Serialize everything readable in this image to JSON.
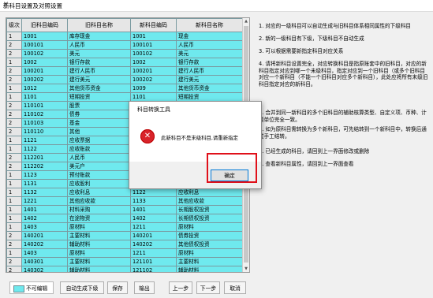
{
  "window": {
    "title": "新科目设置及对照设置",
    "close_glyph": "✕"
  },
  "grid": {
    "headers": [
      "级次",
      "旧科目编码",
      "旧科目名称",
      "新科目编码",
      "新科目名称"
    ],
    "rows": [
      [
        "1",
        "1001",
        "库存现金",
        "1001",
        "现金"
      ],
      [
        "2",
        "100101",
        "人民币",
        "100101",
        "人民币"
      ],
      [
        "2",
        "100102",
        "美元",
        "100102",
        "美元"
      ],
      [
        "1",
        "1002",
        "银行存款",
        "1002",
        "银行存款"
      ],
      [
        "2",
        "100201",
        "建行人民币",
        "100201",
        "建行人民币"
      ],
      [
        "2",
        "100202",
        "建行美元",
        "100202",
        "建行美元"
      ],
      [
        "1",
        "1012",
        "其他货币资金",
        "1009",
        "其他货币资金"
      ],
      [
        "1",
        "1101",
        "短期投资",
        "1101",
        "短期投资"
      ],
      [
        "2",
        "110101",
        "股票",
        "",
        ""
      ],
      [
        "2",
        "110102",
        "债券",
        "",
        ""
      ],
      [
        "2",
        "110103",
        "基金",
        "",
        ""
      ],
      [
        "2",
        "110110",
        "其他",
        "",
        ""
      ],
      [
        "1",
        "1121",
        "应收票据",
        "",
        ""
      ],
      [
        "1",
        "1122",
        "应收账款",
        "",
        ""
      ],
      [
        "2",
        "112201",
        "人民币",
        "",
        ""
      ],
      [
        "2",
        "112202",
        "美元户",
        "",
        ""
      ],
      [
        "1",
        "1123",
        "预付账款",
        "",
        ""
      ],
      [
        "1",
        "1131",
        "应收股利",
        "",
        ""
      ],
      [
        "1",
        "1132",
        "应收利息",
        "1122",
        "应收利息"
      ],
      [
        "1",
        "1221",
        "其他应收款",
        "1133",
        "其他应收款"
      ],
      [
        "1",
        "1401",
        "材料采购",
        "1401",
        "长期股权投资"
      ],
      [
        "1",
        "1402",
        "在途物资",
        "1402",
        "长期债权投资"
      ],
      [
        "1",
        "1403",
        "原材料",
        "1211",
        "原材料"
      ],
      [
        "2",
        "140201",
        "主要材料",
        "140201",
        "债券投资"
      ],
      [
        "2",
        "140202",
        "辅助材料",
        "140202",
        "其他债权投资"
      ],
      [
        "1",
        "1403",
        "原材料",
        "1211",
        "原材料"
      ],
      [
        "2",
        "140301",
        "主要材料",
        "121101",
        "主要材料"
      ],
      [
        "2",
        "140302",
        "辅助材料",
        "121102",
        "辅助材料"
      ],
      [
        "1",
        "1404",
        "材料成本差异",
        "1232",
        "材料成本差异"
      ]
    ]
  },
  "notes": [
    "1. 对应的一级科目可以自动生成与旧科目体系相同属性的下级科目",
    "2. 新的一级科目有下级，下级科目不自动生成",
    "3. 可以根据需要新指定科目对应关系",
    "4. 请将新科目设置完全，对应转换科目是指原账套中的旧科目，对应的新科目指定对应到哪一个未级科目，指定对应到一个旧科目（或多个旧科目对应一个新科目（不能一个旧科目对应多个新科目），此处应将所有末级旧科目指定对应的新科目。",
    "5. 合并到同一新科目的多个旧科目的辅助核算类型、自定义项、币种、计量单位完全一致。",
    "6. 如为原科目需转换为多个新科目，可先结转到一个新科目中，转换后通过手工结转。",
    "7. 已经生成的科目，请回到上一界面修改或删除",
    "8. 查看新科目属性，请回到上一界面查看"
  ],
  "buttons": {
    "legend": "不可编辑",
    "auto_generate": "自动生成下级",
    "save": "保存",
    "export": "输出",
    "prev": "上一步",
    "next": "下一步",
    "cancel": "取消"
  },
  "dialog": {
    "title": "科目转换工具",
    "message": "此新科目不是末级科目,请重新指定",
    "ok": "确定",
    "icon_glyph": "✕"
  },
  "colors": {
    "editable_cell": "#6fe9ee",
    "highlight": "#e0101a",
    "error_icon": "#d8232a"
  }
}
